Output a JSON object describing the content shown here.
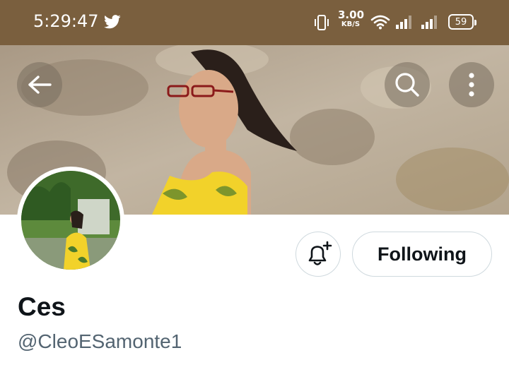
{
  "status_bar": {
    "time": "5:29:47",
    "net_speed_value": "3.00",
    "net_speed_unit": "KB/S",
    "battery": "59",
    "icons": [
      "twitter-icon",
      "vibrate-icon",
      "wifi-icon",
      "signal-icon",
      "signal-icon",
      "battery-icon"
    ],
    "background_color": "#7a5f3e"
  },
  "header": {
    "back_icon": "arrow-left-icon",
    "search_icon": "search-icon",
    "more_icon": "more-vertical-icon"
  },
  "profile": {
    "display_name": "Ces",
    "handle": "@CleoESamonte1",
    "notification_icon": "bell-plus-icon",
    "following_label": "Following"
  },
  "colors": {
    "text_primary": "#0f1419",
    "text_secondary": "#536471",
    "button_border": "#cfd9de"
  }
}
